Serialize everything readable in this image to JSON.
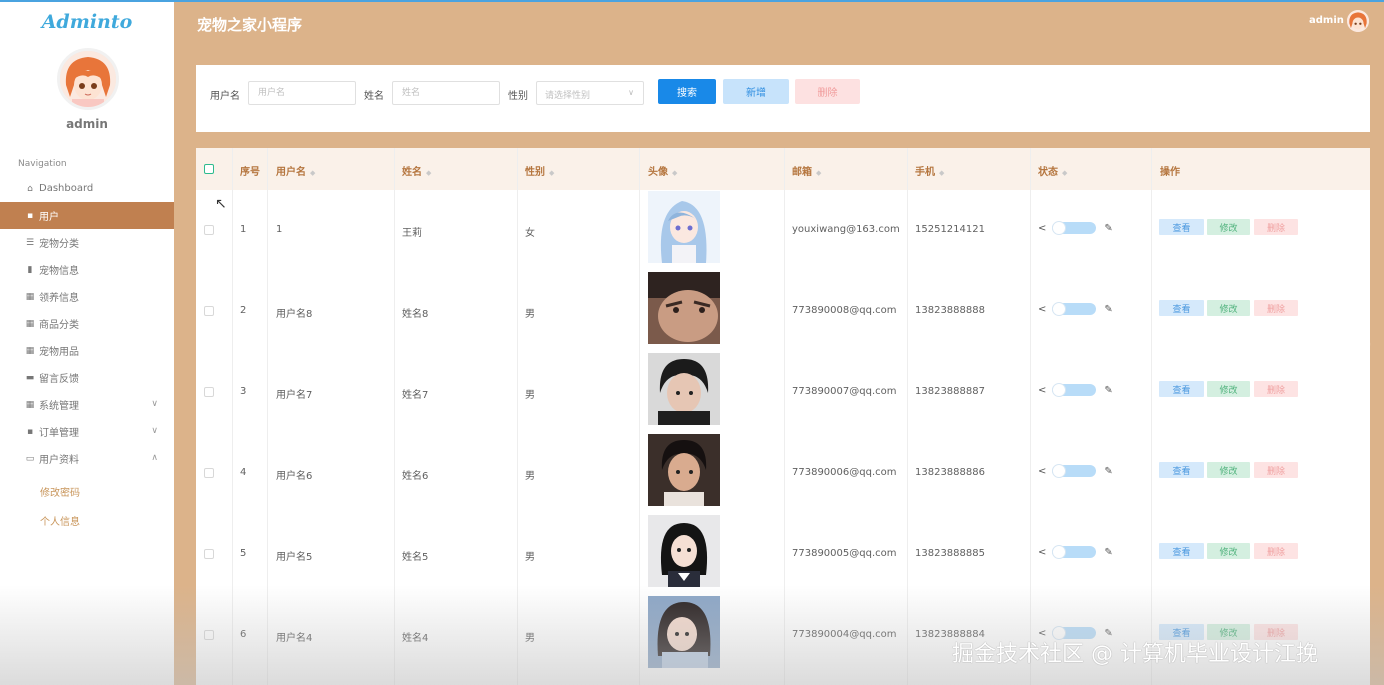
{
  "sidebar": {
    "brand": "Adminto",
    "username": "admin",
    "nav_heading": "Navigation",
    "items": [
      {
        "label": "Dashboard",
        "icon": "home-icon"
      },
      {
        "label": "用户",
        "icon": "user-card-icon",
        "active": true
      },
      {
        "label": "宠物分类",
        "icon": "list-icon"
      },
      {
        "label": "宠物信息",
        "icon": "bar-chart-icon"
      },
      {
        "label": "领养信息",
        "icon": "grid-icon"
      },
      {
        "label": "商品分类",
        "icon": "grid-icon"
      },
      {
        "label": "宠物用品",
        "icon": "grid-icon"
      },
      {
        "label": "留言反馈",
        "icon": "briefcase-icon"
      },
      {
        "label": "系统管理",
        "icon": "grid-icon",
        "expandable": true
      },
      {
        "label": "订单管理",
        "icon": "user-card-icon",
        "expandable": true
      },
      {
        "label": "用户资料",
        "icon": "calendar-icon",
        "expanded": true
      }
    ],
    "sub_items": [
      "修改密码",
      "个人信息"
    ]
  },
  "header": {
    "title": "宠物之家小程序",
    "username": "admin"
  },
  "search": {
    "username_label": "用户名",
    "username_placeholder": "用户名",
    "name_label": "姓名",
    "name_placeholder": "姓名",
    "gender_label": "性别",
    "gender_placeholder": "请选择性别",
    "search_button": "搜索",
    "add_button": "新增",
    "delete_button": "删除"
  },
  "table": {
    "columns": [
      "序号",
      "用户名",
      "姓名",
      "性别",
      "头像",
      "邮箱",
      "手机",
      "状态",
      "操作"
    ],
    "actions": {
      "view": "查看",
      "edit": "修改",
      "delete": "删除"
    },
    "rows": [
      {
        "index": "1",
        "username": "1",
        "name": "王莉",
        "gender": "女",
        "email": "youxiwang@163.com",
        "phone": "15251214121"
      },
      {
        "index": "2",
        "username": "用户名8",
        "name": "姓名8",
        "gender": "男",
        "email": "773890008@qq.com",
        "phone": "13823888888"
      },
      {
        "index": "3",
        "username": "用户名7",
        "name": "姓名7",
        "gender": "男",
        "email": "773890007@qq.com",
        "phone": "13823888887"
      },
      {
        "index": "4",
        "username": "用户名6",
        "name": "姓名6",
        "gender": "男",
        "email": "773890006@qq.com",
        "phone": "13823888886"
      },
      {
        "index": "5",
        "username": "用户名5",
        "name": "姓名5",
        "gender": "男",
        "email": "773890005@qq.com",
        "phone": "13823888885"
      },
      {
        "index": "6",
        "username": "用户名4",
        "name": "姓名4",
        "gender": "男",
        "email": "773890004@qq.com",
        "phone": "13823888884"
      }
    ]
  },
  "watermark": "掘金技术社区 @ 计算机毕业设计江挽",
  "colors": {
    "background": "#dcb38a",
    "sidebar_active": "#c08050",
    "header_text": "#b5763f",
    "primary": "#1989e8",
    "brand": "#3fa9dc"
  }
}
